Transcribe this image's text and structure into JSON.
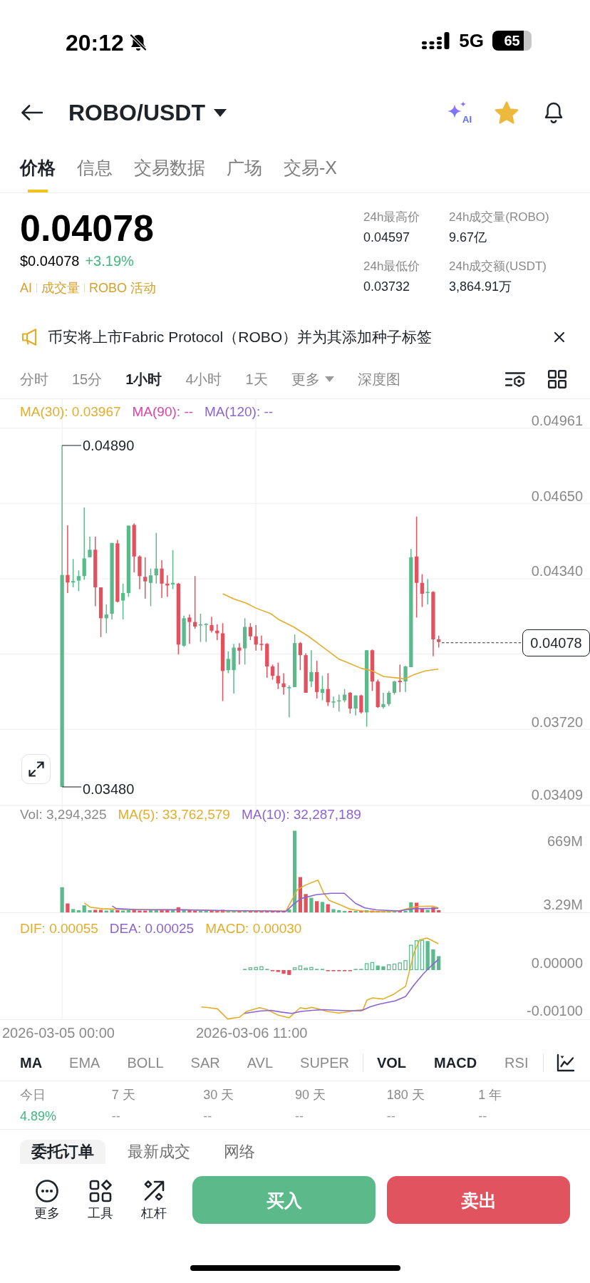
{
  "status_bar": {
    "time": "20:12",
    "network": "5G",
    "battery": "65"
  },
  "header": {
    "title": "ROBO/USDT",
    "assistant_label": "AI",
    "favorite": true
  },
  "tabs": [
    {
      "label": "价格",
      "selected": true
    },
    {
      "label": "信息",
      "selected": false
    },
    {
      "label": "交易数据",
      "selected": false
    },
    {
      "label": "广场",
      "selected": false
    },
    {
      "label": "交易-X",
      "selected": false
    }
  ],
  "price": {
    "last": "0.04078",
    "fiat": "$0.04078",
    "change": "+3.19%",
    "tags": [
      "AI",
      "成交量",
      "ROBO 活动"
    ]
  },
  "stats": [
    {
      "label": "24h最高价",
      "value": "0.04597"
    },
    {
      "label": "24h成交量(ROBO)",
      "value": "9.67亿"
    },
    {
      "label": "24h最低价",
      "value": "0.03732"
    },
    {
      "label": "24h成交额(USDT)",
      "value": "3,864.91万"
    }
  ],
  "notice": {
    "text": "币安将上市Fabric Protocol（ROBO）并为其添加种子标签"
  },
  "intervals": [
    {
      "label": "分时",
      "selected": false,
      "kind": "plain"
    },
    {
      "label": "15分",
      "selected": false,
      "kind": "plain"
    },
    {
      "label": "1小时",
      "selected": true,
      "kind": "plain"
    },
    {
      "label": "4小时",
      "selected": false,
      "kind": "plain"
    },
    {
      "label": "1天",
      "selected": false,
      "kind": "plain"
    },
    {
      "label": "更多",
      "selected": false,
      "kind": "dropdown"
    },
    {
      "label": "深度图",
      "selected": false,
      "kind": "plain"
    }
  ],
  "chart": {
    "legend": [
      {
        "label": "MA(30): 0.03967",
        "color": "#e3ad2c"
      },
      {
        "label": "MA(90): --",
        "color": "#e043a3"
      },
      {
        "label": "MA(120): --",
        "color": "#8b64d4"
      }
    ],
    "price_axis": [
      "0.04961",
      "0.04650",
      "0.04340",
      "0.03720",
      "0.03409"
    ],
    "high": "0.04890",
    "low": "0.03480",
    "last": "0.04078"
  },
  "volume": {
    "legend": [
      {
        "label": "Vol: 3,294,325",
        "color": "#8a8a8a"
      },
      {
        "label": "MA(5): 33,762,579",
        "color": "#e3ad2c"
      },
      {
        "label": "MA(10): 32,287,189",
        "color": "#8b64d4"
      }
    ],
    "axis": [
      "669M",
      "3.29M"
    ]
  },
  "macd": {
    "legend": [
      {
        "label": "DIF: 0.00055",
        "color": "#e3ad2c"
      },
      {
        "label": "DEA: 0.00025",
        "color": "#8b64d4"
      },
      {
        "label": "MACD: 0.00030",
        "color": "#e3ad2c"
      }
    ],
    "axis": [
      "0.00000",
      "-0.00100"
    ]
  },
  "time_axis": [
    "2026-03-05 00:00",
    "2026-03-06 11:00"
  ],
  "indicators": {
    "main": [
      {
        "label": "MA",
        "selected": true
      },
      {
        "label": "EMA",
        "selected": false
      },
      {
        "label": "BOLL",
        "selected": false
      },
      {
        "label": "SAR",
        "selected": false
      },
      {
        "label": "AVL",
        "selected": false
      },
      {
        "label": "SUPER",
        "selected": false
      }
    ],
    "sub": [
      {
        "label": "VOL",
        "selected": true
      },
      {
        "label": "MACD",
        "selected": true
      },
      {
        "label": "RSI",
        "selected": false
      }
    ]
  },
  "performance": [
    {
      "period": "今日",
      "value": "4.89%",
      "color": "#3fb87f"
    },
    {
      "period": "7 天",
      "value": "--",
      "color": "#9a9a9a"
    },
    {
      "period": "30 天",
      "value": "--",
      "color": "#9a9a9a"
    },
    {
      "period": "90 天",
      "value": "--",
      "color": "#9a9a9a"
    },
    {
      "period": "180 天",
      "value": "--",
      "color": "#9a9a9a"
    },
    {
      "period": "1 年",
      "value": "--",
      "color": "#9a9a9a"
    }
  ],
  "order_tabs": [
    {
      "label": "委托订单",
      "selected": true
    },
    {
      "label": "最新成交",
      "selected": false
    },
    {
      "label": "网络",
      "selected": false
    }
  ],
  "tools": [
    {
      "label": "更多",
      "kind": "more"
    },
    {
      "label": "工具",
      "kind": "tools"
    },
    {
      "label": "杠杆",
      "kind": "leverage"
    }
  ],
  "trade_buttons": [
    {
      "label": "买入",
      "kind": "buy"
    },
    {
      "label": "卖出",
      "kind": "sell"
    }
  ]
}
